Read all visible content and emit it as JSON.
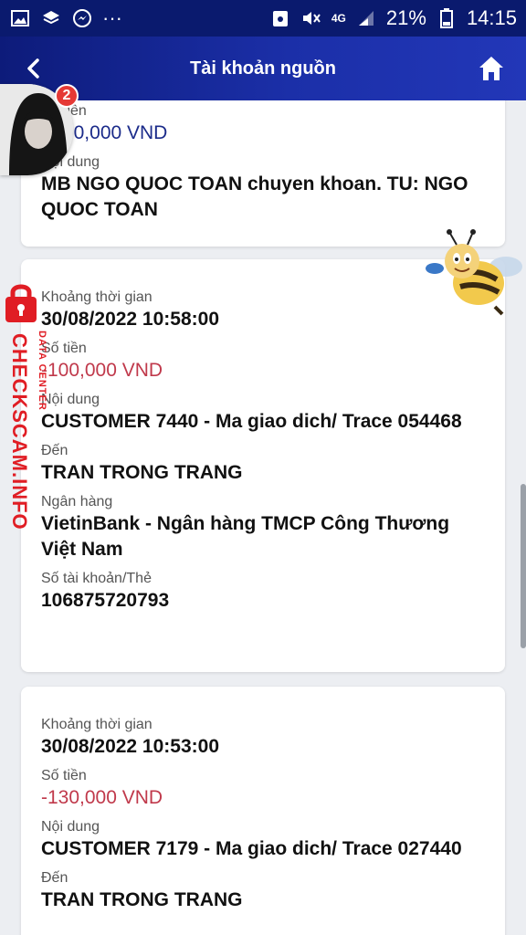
{
  "status_bar": {
    "network": "4G",
    "battery": "21%",
    "time": "14:15",
    "more": "···"
  },
  "header": {
    "title": "Tài khoản nguồn"
  },
  "avatar": {
    "badge_count": "2"
  },
  "transactions": [
    {
      "amount_label": "Số tiền",
      "amount": "+100,000 VND",
      "content_label": "Nội dung",
      "content": "MB NGO QUOC TOAN chuyen khoan. TU: NGO QUOC TOAN"
    },
    {
      "time_label": "Khoảng thời gian",
      "time": "30/08/2022 10:58:00",
      "amount_label": "Số tiền",
      "amount": "-100,000 VND",
      "content_label": "Nội dung",
      "content": "CUSTOMER 7440 - Ma giao dich/ Trace 054468",
      "to_label": "Đến",
      "to": "TRAN TRONG TRANG",
      "bank_label": "Ngân hàng",
      "bank": "VietinBank - Ngân hàng TMCP Công Thương Việt Nam",
      "account_label": "Số tài khoản/Thẻ",
      "account": "106875720793"
    },
    {
      "time_label": "Khoảng thời gian",
      "time": "30/08/2022 10:53:00",
      "amount_label": "Số tiền",
      "amount": "-130,000 VND",
      "content_label": "Nội dung",
      "content": "CUSTOMER 7179 - Ma giao dich/ Trace 027440",
      "to_label": "Đến",
      "to": "TRAN TRONG TRANG"
    }
  ],
  "watermark": {
    "main": "CHECKSCAM.INFO",
    "sub": "DATA CENTER"
  },
  "colors": {
    "header_bg": "#0d1b7a",
    "amount_in": "#1b2b8a",
    "amount_out": "#c0394b",
    "badge": "#e53935",
    "watermark": "#e01d24"
  }
}
